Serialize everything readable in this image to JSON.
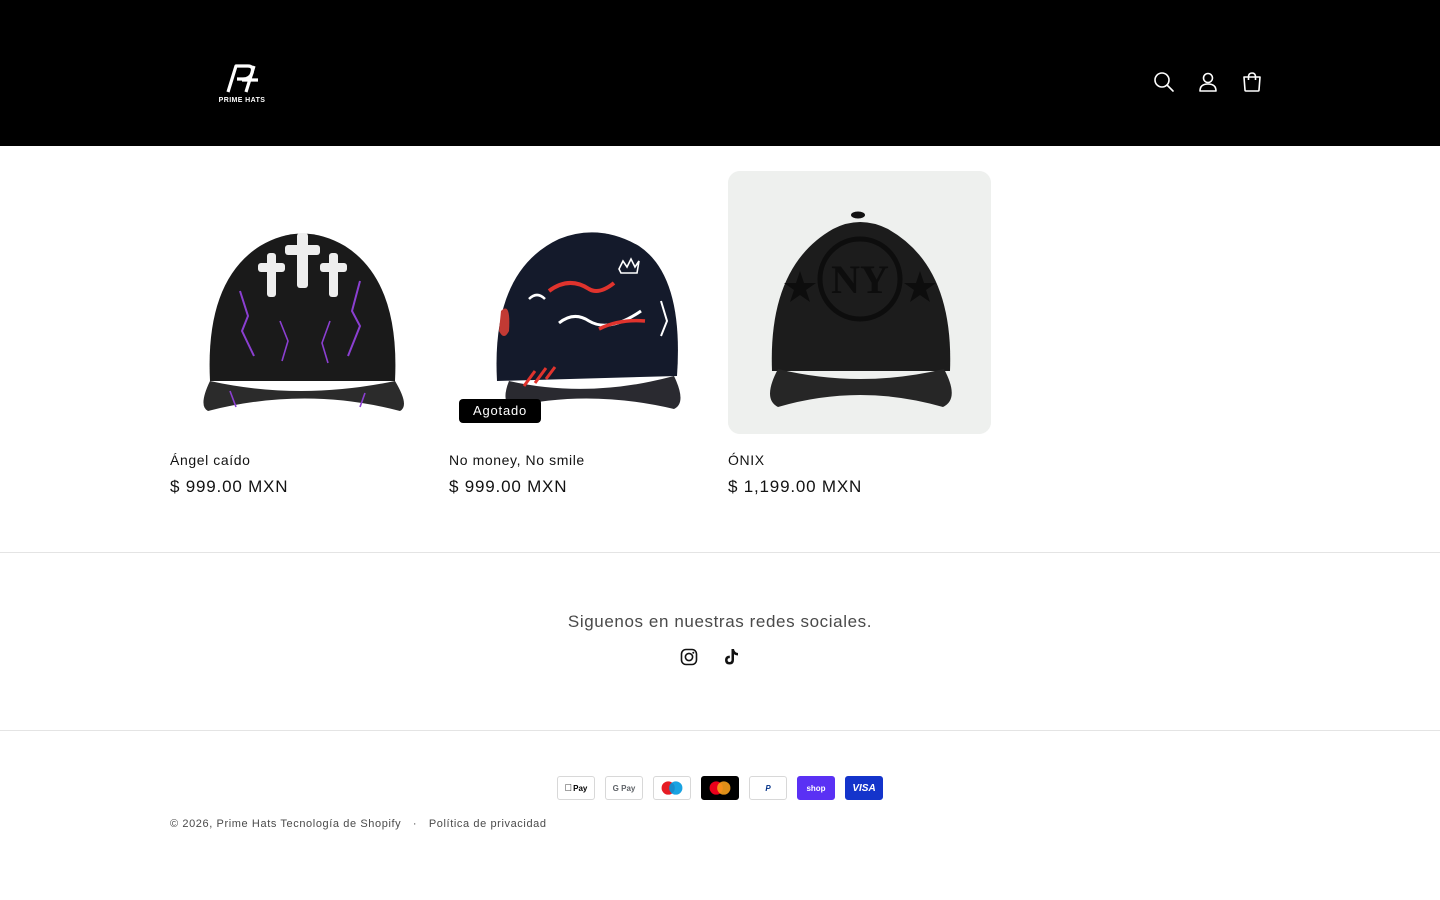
{
  "header": {
    "logo_text": "PRIME HATS",
    "icons": [
      "search-icon",
      "account-icon",
      "cart-icon"
    ]
  },
  "products": [
    {
      "title": "Ángel caído",
      "price": "$ 999.00 MXN",
      "badge": ""
    },
    {
      "title": "No money, No smile",
      "price": "$ 999.00 MXN",
      "badge": "Agotado"
    },
    {
      "title": "ÓNIX",
      "price": "$ 1,199.00 MXN",
      "badge": ""
    }
  ],
  "footer": {
    "social_heading": "Siguenos en nuestras redes sociales.",
    "social_icons": [
      "instagram-icon",
      "tiktok-icon"
    ],
    "payments": {
      "apple": "Pay",
      "google": "G Pay",
      "maestro": "maestro",
      "mastercard": "mastercard",
      "paypal": "P",
      "shop": "shop",
      "visa": "VISA"
    },
    "copyright_prefix": "© 2026,",
    "store_name": "Prime Hats",
    "powered_by": "Tecnología de Shopify",
    "separator": "·",
    "privacy": "Política de privacidad"
  },
  "colors": {
    "header_bg": "#000000",
    "badge_bg": "#000000",
    "shop_pay": "#5a31f4",
    "visa": "#1434cb"
  }
}
